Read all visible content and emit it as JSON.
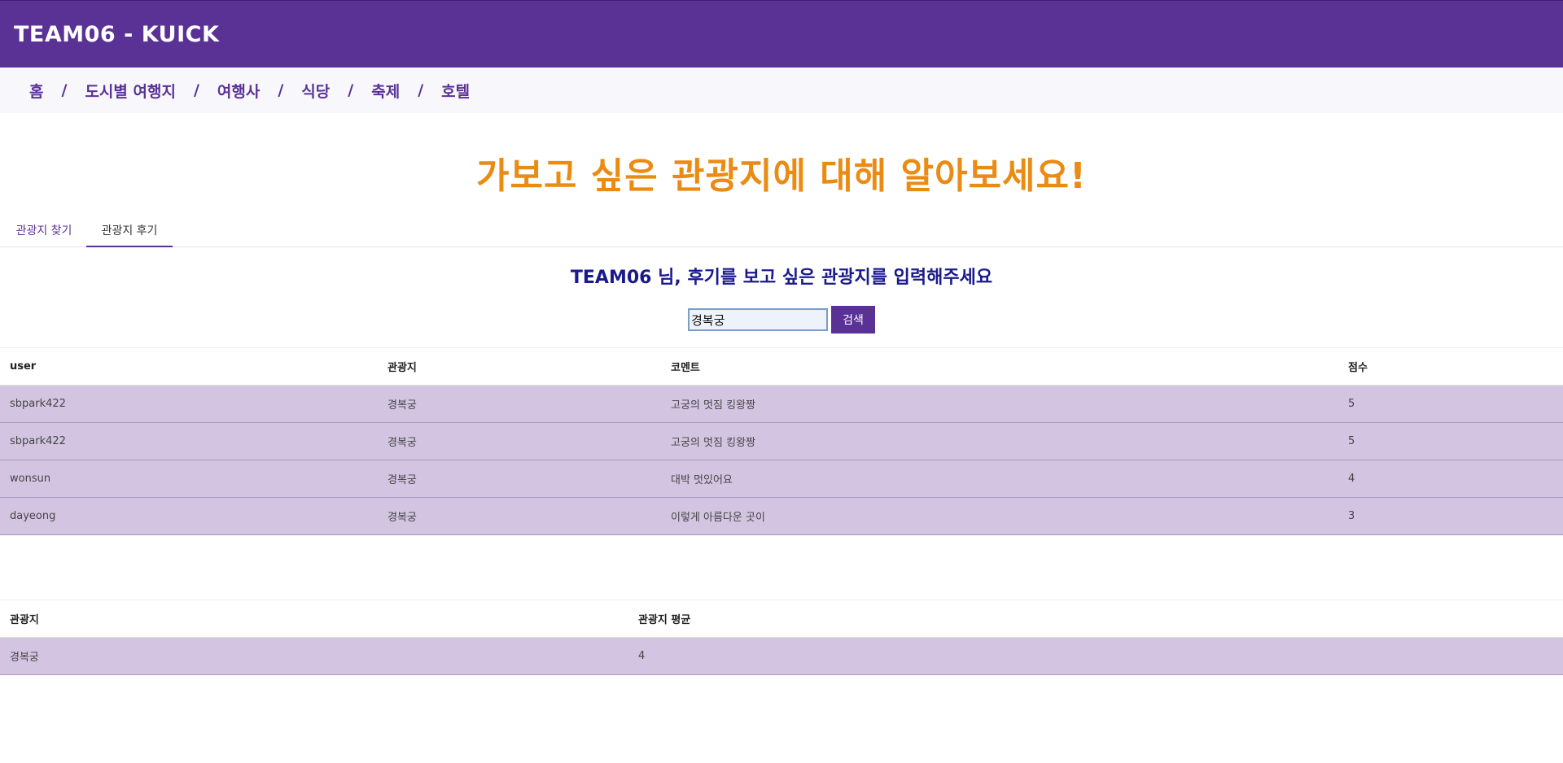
{
  "header": {
    "title": "TEAM06 - KUICK"
  },
  "nav": {
    "items": [
      "홈",
      "도시별 여행지",
      "여행사",
      "식당",
      "축제",
      "호텔"
    ],
    "separator": "/"
  },
  "hero": {
    "title": "가보고 싶은 관광지에 대해 알아보세요!"
  },
  "tabs": [
    {
      "label": "관광지 찾기",
      "active": false
    },
    {
      "label": "관광지 후기",
      "active": true
    }
  ],
  "review_search": {
    "subtitle": "TEAM06 님, 후기를 보고 싶은 관광지를 입력해주세요",
    "input_value": "경복궁",
    "button_label": "검색"
  },
  "reviews_table": {
    "headers": [
      "user",
      "관광지",
      "코멘트",
      "점수"
    ],
    "rows": [
      [
        "sbpark422",
        "경복궁",
        "고궁의 멋짐 킹왕짱",
        "5"
      ],
      [
        "sbpark422",
        "경복궁",
        "고궁의 멋짐 킹왕짱",
        "5"
      ],
      [
        "wonsun",
        "경복궁",
        "대박 멋있어요",
        "4"
      ],
      [
        "dayeong",
        "경복궁",
        "이렇게 아름다운 곳이",
        "3"
      ]
    ]
  },
  "average_table": {
    "headers": [
      "관광지",
      "관광지 평균"
    ],
    "rows": [
      [
        "경복궁",
        "4"
      ]
    ]
  },
  "colors": {
    "header_bg": "#5a3296",
    "hero_text": "#ea8c14",
    "subtitle_text": "#1a1a8c",
    "row_bg": "#d3c5e2"
  }
}
